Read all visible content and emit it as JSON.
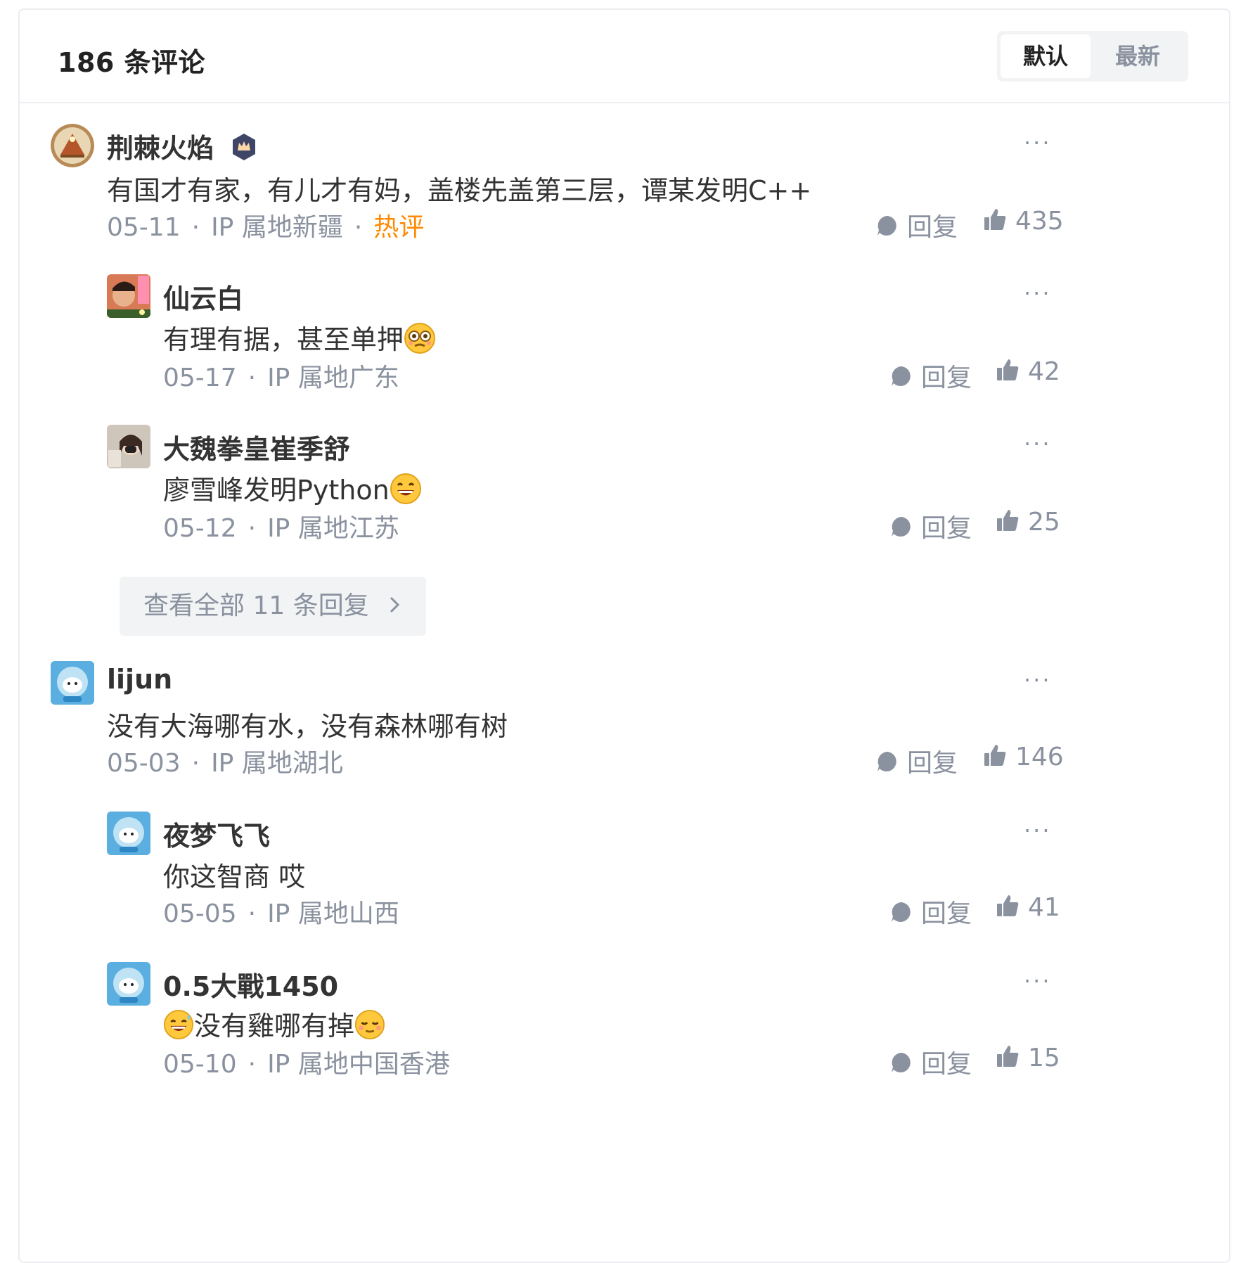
{
  "header": {
    "count_label": "186 条评论",
    "sort_default": "默认",
    "sort_latest": "最新"
  },
  "colors": {
    "accent_hot": "#ff8a00",
    "muted": "#8a919f",
    "text": "#333333"
  },
  "icons": {
    "more": "more-icon",
    "reply": "comment-bubble-icon",
    "like": "thumbs-up-icon",
    "vip": "crown-badge-icon",
    "chevron": "chevron-right-icon"
  },
  "comments": [
    {
      "name": "荆棘火焰",
      "text": "有国才有家，有儿才有妈，盖楼先盖第三层，谭某发明C++",
      "date": "05-11",
      "ip": "IP 属地新疆",
      "tag": "热评",
      "reply_label": "回复",
      "likes": "435",
      "more": "···",
      "replies": [
        {
          "name": "仙云白",
          "text": "有理有据，甚至单押",
          "date": "05-17",
          "ip": "IP 属地广东",
          "reply_label": "回复",
          "likes": "42",
          "more": "···"
        },
        {
          "name": "大魏拳皇崔季舒",
          "text": "廖雪峰发明Python",
          "date": "05-12",
          "ip": "IP 属地江苏",
          "reply_label": "回复",
          "likes": "25",
          "more": "···"
        }
      ],
      "view_all": "查看全部 11 条回复"
    },
    {
      "name": "lijun",
      "text": "没有大海哪有水，没有森林哪有树",
      "date": "05-03",
      "ip": "IP 属地湖北",
      "reply_label": "回复",
      "likes": "146",
      "more": "···",
      "replies": [
        {
          "name": "夜梦飞飞",
          "text": "你这智商 哎",
          "date": "05-05",
          "ip": "IP 属地山西",
          "reply_label": "回复",
          "likes": "41",
          "more": "···"
        },
        {
          "name": "0.5大戰1450",
          "text": "没有雞哪有掉",
          "date": "05-10",
          "ip": "IP 属地中国香港",
          "reply_label": "回复",
          "likes": "15",
          "more": "···"
        }
      ]
    }
  ]
}
